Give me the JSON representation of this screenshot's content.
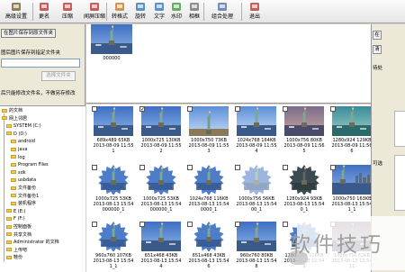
{
  "toolbar": {
    "items": [
      {
        "label": "高级设置",
        "icon": "advanced-settings-icon"
      },
      {
        "label": "更名",
        "icon": "rename-icon"
      },
      {
        "label": "压缩",
        "icon": "compress-icon"
      },
      {
        "label": "闻屏压缩",
        "icon": "screen-compress-icon"
      },
      {
        "label": "转格式",
        "icon": "convert-format-icon"
      },
      {
        "label": "旋转",
        "icon": "rotate-icon"
      },
      {
        "label": "文字",
        "icon": "text-icon"
      },
      {
        "label": "水印",
        "icon": "watermark-icon"
      },
      {
        "label": "相框",
        "icon": "frame-icon"
      },
      {
        "label": "组合处理",
        "icon": "combine-process-icon"
      },
      {
        "label": "退出",
        "icon": "exit-icon"
      }
    ]
  },
  "left": {
    "save_original_button": "在图片保存到原文件夹",
    "save_to_folder_label": "图后图片保存到指定文件夹",
    "folder_path_value": "",
    "browse_button": "选择文件夹",
    "keep_name_label": "后只能修改文件名，不做另存修改"
  },
  "tree": [
    {
      "label": "的文档",
      "indent": 0
    },
    {
      "label": "网上邻居",
      "indent": 0
    },
    {
      "label": "SYSTEM (C:)",
      "indent": 1
    },
    {
      "label": "D (D:)",
      "indent": 1
    },
    {
      "label": "android",
      "indent": 2
    },
    {
      "label": "java",
      "indent": 2
    },
    {
      "label": "log",
      "indent": 2
    },
    {
      "label": "Program Files",
      "indent": 2
    },
    {
      "label": "sdk",
      "indent": 2
    },
    {
      "label": "usbdata",
      "indent": 2
    },
    {
      "label": "文件备份",
      "indent": 2
    },
    {
      "label": "文件备份1",
      "indent": 2
    },
    {
      "label": "装机程序",
      "indent": 2
    },
    {
      "label": "E (E:)",
      "indent": 1
    },
    {
      "label": "F (F:)",
      "indent": 1
    },
    {
      "label": "控制面板",
      "indent": 1
    },
    {
      "label": "共享文档",
      "indent": 1
    },
    {
      "label": "Administrator 的文档",
      "indent": 1
    },
    {
      "label": "上传吧",
      "indent": 1
    },
    {
      "label": "鞋份",
      "indent": 1
    }
  ],
  "strip": {
    "caption": "000000"
  },
  "thumbnails": [
    {
      "checked": false,
      "info": "689x489 65KB",
      "date": "2013-08-09 11:55",
      "name": "1",
      "style": "liberty-boats"
    },
    {
      "checked": true,
      "info": "1000x725 130KB",
      "date": "2013-08-09 11:55",
      "name": "2",
      "style": "liberty-boats"
    },
    {
      "checked": false,
      "info": "1000x750 73KB",
      "date": "2013-08-09 11:55",
      "name": "3",
      "style": "liberty-close"
    },
    {
      "checked": false,
      "info": "1024x768 164KB",
      "date": "2013-08-09 11:55",
      "name": "4",
      "style": "liberty-sky"
    },
    {
      "checked": false,
      "info": "1000x756 80KB",
      "date": "2013-08-09 11:56",
      "name": "5",
      "style": "liberty-dusk"
    },
    {
      "checked": false,
      "info": "1280x924 129KB",
      "date": "2013-08-09 11:56",
      "name": "6",
      "style": "liberty-green"
    },
    {
      "checked": false,
      "info": "1000x725 53KB",
      "date": "2013-08-13 15:54",
      "name": "000000_1",
      "style": "star-boats"
    },
    {
      "checked": false,
      "info": "1000x725 53KB",
      "date": "2013-08-13 15:54",
      "name": "000000_1",
      "style": "star-boats"
    },
    {
      "checked": false,
      "info": "1024x768 116KB",
      "date": "2013-08-13 15:54",
      "name": "0000_1",
      "style": "star-boats"
    },
    {
      "checked": false,
      "info": "1000x756 56KB",
      "date": "2013-08-13 15:54",
      "name": "00_1",
      "style": "star-fade"
    },
    {
      "checked": false,
      "info": "1280x924 93KB",
      "date": "2013-08-13 15:54",
      "name": "0_1",
      "style": "star-dark"
    },
    {
      "checked": false,
      "info": "1000x750 163KB",
      "date": "2013-08-13 15:54",
      "name": "1_1",
      "style": "liberty-city"
    },
    {
      "checked": false,
      "info": "960x760 107KB",
      "date": "2013-08-13 15:54",
      "name": "1_1",
      "style": "star-boats"
    },
    {
      "checked": false,
      "info": "651x468 43KB",
      "date": "2013-08-13 15:54",
      "name": "4",
      "style": "liberty-boats"
    },
    {
      "checked": false,
      "info": "651x468 43KB",
      "date": "2013-08-13 15:54",
      "name": "6",
      "style": "star-boats"
    },
    {
      "checked": false,
      "info": "960x760 80KB",
      "date": "2013-08-13 15:54",
      "name": "8",
      "style": "liberty-boats"
    },
    {
      "checked": false,
      "info": "1280x960 126KB",
      "date": "2013-08-13 15:54",
      "name": "9",
      "style": "star-boats"
    },
    {
      "checked": false,
      "info": "1000x756 62KB",
      "date": "2013-08-13 15:54",
      "name": "11",
      "style": "liberty-dusk"
    }
  ],
  "right": {
    "button_1": "在",
    "button_2": "清",
    "label_1": "待处",
    "label_2": "可选"
  },
  "watermark": "软件技巧",
  "colors": {
    "accent": "#2e5db8",
    "sky": "#3e6fc2",
    "water": "#3a5a8a",
    "statue": "#7ea88f",
    "folder": "#f2c94c"
  }
}
